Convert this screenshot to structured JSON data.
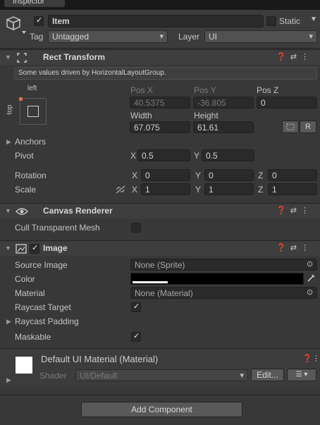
{
  "tab": {
    "label": "Inspector"
  },
  "header": {
    "name_value": "Item",
    "static_label": "Static",
    "tag_label": "Tag",
    "tag_value": "Untagged",
    "layer_label": "Layer",
    "layer_value": "UI"
  },
  "rect_transform": {
    "title": "Rect Transform",
    "notice": "Some values driven by HorizontalLayoutGroup.",
    "anchor_h": "left",
    "anchor_v": "top",
    "pos_x_label": "Pos X",
    "pos_x": "40.5375",
    "pos_y_label": "Pos Y",
    "pos_y": "-36.805",
    "pos_z_label": "Pos Z",
    "pos_z": "0",
    "width_label": "Width",
    "width": "67.075",
    "height_label": "Height",
    "height": "61.61",
    "r_button": "R",
    "anchors_label": "Anchors",
    "pivot_label": "Pivot",
    "pivot_x": "0.5",
    "pivot_y": "0.5",
    "rotation_label": "Rotation",
    "rot_x": "0",
    "rot_y": "0",
    "rot_z": "0",
    "scale_label": "Scale",
    "scale_x": "1",
    "scale_y": "1",
    "scale_z": "1",
    "x": "X",
    "y": "Y",
    "z": "Z"
  },
  "canvas_renderer": {
    "title": "Canvas Renderer",
    "cull_label": "Cull Transparent Mesh"
  },
  "image": {
    "title": "Image",
    "source_label": "Source Image",
    "source_value": "None (Sprite)",
    "color_label": "Color",
    "material_label": "Material",
    "material_value": "None (Material)",
    "raycast_label": "Raycast Target",
    "padding_label": "Raycast Padding",
    "maskable_label": "Maskable"
  },
  "material": {
    "title": "Default UI Material (Material)",
    "shader_label": "Shader",
    "shader_value": "UI/Default",
    "edit_button": "Edit..."
  },
  "add_component": "Add Component",
  "colors": {
    "panel": "#383838",
    "field": "#2a2a2a",
    "accent_check": "#e8e8e8"
  }
}
